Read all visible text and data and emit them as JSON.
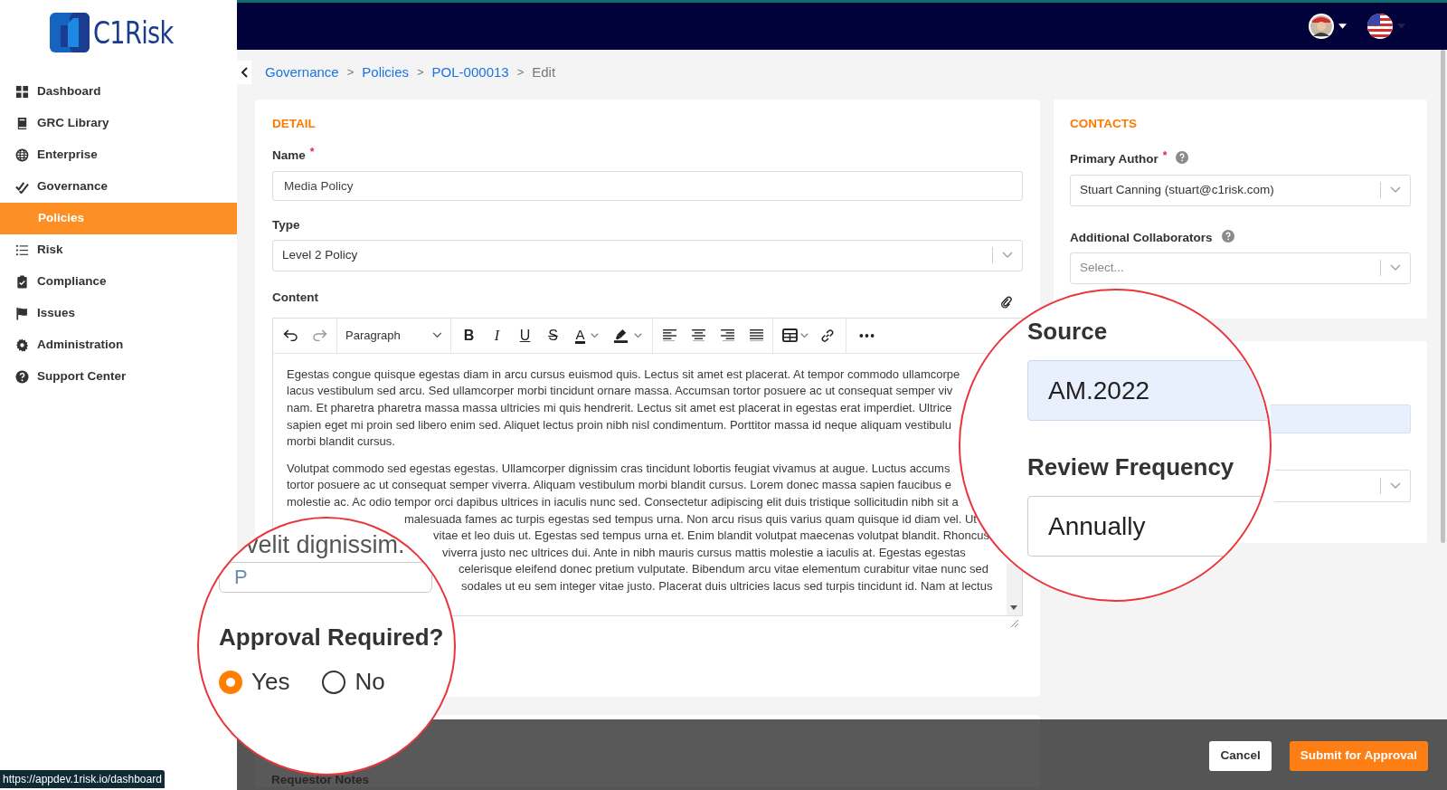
{
  "logo": {
    "text": "C1Risk"
  },
  "sidebar": {
    "items": [
      {
        "label": "Dashboard",
        "kind": "grid",
        "selected": false
      },
      {
        "label": "GRC Library",
        "kind": "book",
        "selected": false
      },
      {
        "label": "Enterprise",
        "kind": "globe",
        "selected": false
      },
      {
        "label": "Governance",
        "kind": "check",
        "selected": false,
        "children": [
          {
            "label": "Policies",
            "selected": true
          }
        ]
      },
      {
        "label": "Risk",
        "kind": "list",
        "selected": false
      },
      {
        "label": "Compliance",
        "kind": "clipboard",
        "selected": false
      },
      {
        "label": "Issues",
        "kind": "flag",
        "selected": false
      },
      {
        "label": "Administration",
        "kind": "gear",
        "selected": false
      },
      {
        "label": "Support Center",
        "kind": "help",
        "selected": false
      }
    ]
  },
  "breadcrumb": [
    {
      "label": "Governance",
      "kind": "link"
    },
    {
      "label": "Policies",
      "kind": "link"
    },
    {
      "label": "POL-000013",
      "kind": "link"
    },
    {
      "label": "Edit",
      "kind": "current"
    }
  ],
  "breadcrumb_separator": ">",
  "detail": {
    "heading": "DETAIL",
    "name": {
      "label": "Name",
      "required_mark": "*",
      "value": "Media Policy"
    },
    "type": {
      "label": "Type",
      "value": "Level 2 Policy"
    },
    "content": {
      "label": "Content",
      "block_format": "Paragraph",
      "format_buttons": [
        "B",
        "I",
        "U",
        "S"
      ],
      "color_button": "A",
      "paragraphs": [
        [
          "Egestas congue quisque egestas diam in arcu cursus euismod quis. Lectus sit amet est placerat. At tempor commodo ullamcorpe",
          "lacus vestibulum sed arcu. Sed ullamcorper morbi tincidunt ornare massa. Accumsan tortor posuere ac ut consequat semper viv",
          "nam. Et pharetra pharetra massa massa ultricies mi quis hendrerit. Lectus sit amet est placerat in egestas erat imperdiet. Ultrice",
          "sapien eget mi proin sed libero enim sed. Aliquet lectus proin nibh nisl condimentum. Porttitor massa id neque aliquam vestibulu",
          "morbi blandit cursus."
        ],
        [
          "Volutpat commodo sed egestas egestas. Ullamcorper dignissim cras tincidunt lobortis feugiat vivamus at augue. Luctus accums",
          "tortor posuere ac ut consequat semper viverra. Aliquam vestibulum morbi blandit cursus. Lorem donec massa sapien faucibus e",
          "molestie ac. Ac odio tempor orci dapibus ultrices in iaculis nunc sed. Consectetur adipiscing elit duis tristique sollicitudin nibh sit a",
          "malesuada fames ac turpis egestas sed tempus urna. Non arcu risus quis varius quam quisque id diam vel. Ut",
          "vitae et leo duis ut. Egestas sed tempus urna et. Enim blandit volutpat maecenas volutpat blandit. Rhoncus",
          "viverra justo nec ultrices dui. Ante in nibh mauris cursus mattis molestie a iaculis at. Egestas egestas",
          "celerisque eleifend donec pretium vulputate. Bibendum arcu vitae elementum curabitur vitae nunc sed",
          "sodales ut eu sem integer vitae justo. Placerat duis ultricies lacus sed turpis tincidunt id. Nam at lectus"
        ]
      ]
    }
  },
  "contacts": {
    "heading": "CONTACTS",
    "primary_author": {
      "label": "Primary Author",
      "required_mark": "*",
      "value": "Stuart Canning (stuart@c1risk.com)"
    },
    "collaborators": {
      "label": "Additional Collaborators",
      "placeholder": "Select..."
    }
  },
  "magnifier_left": {
    "text": "velit dignissim.",
    "input_value": "P",
    "question": "Approval Required?",
    "options": [
      {
        "label": "Yes",
        "selected": true
      },
      {
        "label": "No",
        "selected": false
      }
    ]
  },
  "magnifier_right": {
    "fields": [
      {
        "label": "Source",
        "value": "AM.2022",
        "kind": "highlighted"
      },
      {
        "label": "Review Frequency",
        "value": "Annually",
        "kind": "plain"
      }
    ]
  },
  "footer": {
    "faint_label": "Requestor Notes",
    "buttons": [
      {
        "label": "Cancel",
        "kind": "secondary"
      },
      {
        "label": "Submit for Approval",
        "kind": "primary"
      }
    ]
  },
  "status_url": "https://appdev.1risk.io/dashboard"
}
